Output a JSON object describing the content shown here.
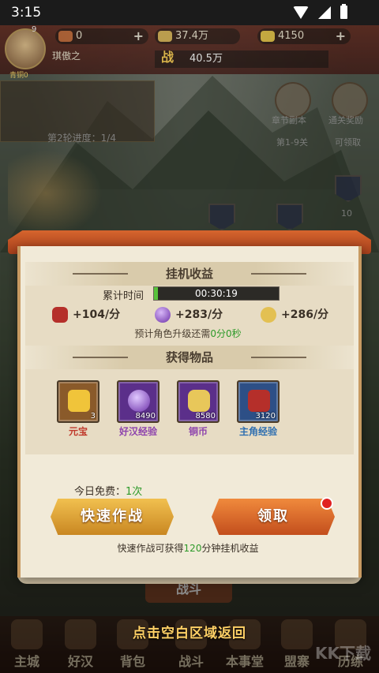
{
  "status_bar": {
    "time": "3:15"
  },
  "top_bar": {
    "level": "9",
    "avatar_sub": "青铜0",
    "player_name": "琪傲之",
    "resources": [
      {
        "icon": "meat-icon",
        "value": "0"
      },
      {
        "icon": "coin-icon",
        "value": "37.4万"
      },
      {
        "icon": "gold-ingot-icon",
        "value": "4150"
      }
    ],
    "power_icon": "战",
    "power_value": "40.5万"
  },
  "background": {
    "progress_text": "第2轮进度：1/4",
    "chapter_label": "章节副本",
    "chapter_sub": "第1-9关",
    "reward_label": "通关奖励",
    "reward_sub": "可领取",
    "banner_count": "10",
    "battle_label": "战斗",
    "return_hint": "点击空白区域返回",
    "watermark": "KK下载"
  },
  "bottom_nav": [
    {
      "label": "主城",
      "icon": "city-icon"
    },
    {
      "label": "好汉",
      "icon": "hero-icon"
    },
    {
      "label": "背包",
      "icon": "bag-icon"
    },
    {
      "label": "战斗",
      "icon": "battle-icon"
    },
    {
      "label": "本事堂",
      "icon": "hall-icon"
    },
    {
      "label": "盟寨",
      "icon": "alliance-icon"
    },
    {
      "label": "历练",
      "icon": "training-icon"
    }
  ],
  "modal": {
    "idle_title": "挂机收益",
    "time_label": "累计时间",
    "time_value": "00:30:19",
    "time_progress": 0.03,
    "rates": [
      {
        "icon": "exp-jar-icon",
        "text": "+104/分"
      },
      {
        "icon": "purple-orb-icon",
        "text": "+283/分"
      },
      {
        "icon": "coin-icon",
        "text": "+286/分"
      }
    ],
    "upgrade_hint_prefix": "预计角色升级还需",
    "upgrade_hint_value": "0分0秒",
    "items_title": "获得物品",
    "items": [
      {
        "name": "元宝",
        "count": "3",
        "color": "#c0392b",
        "bg": "#8a5a2a",
        "icon": "gold-ingot-icon"
      },
      {
        "name": "好汉经验",
        "count": "8490",
        "color": "#8e44ad",
        "bg": "#5b2f8a",
        "icon": "purple-orb-icon"
      },
      {
        "name": "铜币",
        "count": "8580",
        "color": "#8e44ad",
        "bg": "#5b2f8a",
        "icon": "coin-icon"
      },
      {
        "name": "主角经验",
        "count": "3120",
        "color": "#2f6fb0",
        "bg": "#2d4f86",
        "icon": "exp-jar-icon"
      }
    ],
    "free_today_label": "今日免费：",
    "free_today_value": "1次",
    "quick_battle_button": "快速作战",
    "claim_button": "领取",
    "quick_hint_prefix": "快速作战可获得",
    "quick_hint_value": "120",
    "quick_hint_suffix": "分钟挂机收益"
  },
  "colors": {
    "panel": "#f1ead8",
    "header_strip": "#d6652e",
    "accent_green": "#2e9a2a",
    "claim_button": "#d8632a",
    "quick_button": "#e0a53a"
  }
}
